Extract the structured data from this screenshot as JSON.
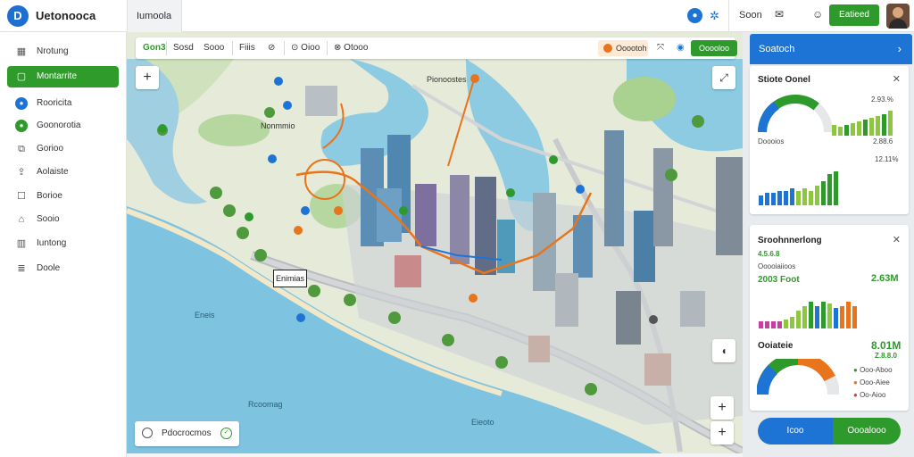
{
  "app": {
    "name": "Uetonooca",
    "tab": "Iumoola"
  },
  "topbar": {
    "search_label": "Soon",
    "action_label": "Eatieed"
  },
  "sidebar": {
    "items": [
      {
        "label": "Nrotung",
        "icon": "grid-icon"
      },
      {
        "label": "Montarrite",
        "icon": "square-icon"
      },
      {
        "label": "Rooricita",
        "icon": "blue-dot-icon"
      },
      {
        "label": "Goonorotia",
        "icon": "green-dot-icon"
      },
      {
        "label": "Gorioo",
        "icon": "stack-icon"
      },
      {
        "label": "Aolaiste",
        "icon": "share-icon"
      },
      {
        "label": "Borioe",
        "icon": "box-icon"
      },
      {
        "label": "Sooio",
        "icon": "home-icon"
      },
      {
        "label": "Iuntong",
        "icon": "chart-icon"
      },
      {
        "label": "Doole",
        "icon": "layers-icon"
      }
    ]
  },
  "map": {
    "toolbar": {
      "first": "Gon3",
      "items": [
        "Sosd",
        "Sooo",
        "Fiiis",
        "Oioo",
        "Otooo"
      ],
      "orange_label": "Ooootoh",
      "green_label": "Ooooloo"
    },
    "labels": {
      "place_top": "Pionoostes",
      "callout": "Enimias",
      "water1": "Eneis",
      "water2": "Rcoomag",
      "water3": "Eieoto",
      "district": "Nonmmio"
    },
    "bottom_search": "Pdocrocmos"
  },
  "panel": {
    "header": "Soatoch",
    "card1": {
      "title": "Stiote Oonel",
      "v1": "2.93.%",
      "v2": "2.88.6",
      "label": "Doooios",
      "v3": "12.11%",
      "gauge_level": 0.72,
      "bars_a": [
        6,
        5,
        6,
        7,
        8,
        9,
        10,
        11,
        12,
        14
      ],
      "bars_b": [
        4,
        5,
        5,
        6,
        6,
        7,
        6,
        7,
        6,
        8,
        10,
        13,
        14
      ]
    },
    "card2": {
      "title": "Sroohnnerlong",
      "stars": "4.5.6.8",
      "small1": "Ooooiaiioos",
      "big_left": "2003 Foot",
      "big_right": "2.63M",
      "bars": [
        3,
        3,
        3,
        3,
        4,
        5,
        8,
        10,
        12,
        10,
        12,
        11,
        9,
        10,
        12,
        10
      ],
      "section": "Ooiateie",
      "big_value": "8.01M",
      "big_sub": "Z.8.8.0",
      "legend": [
        "Ooo-Aboo",
        "Ooo-Aiee",
        "Oo-Aioo"
      ],
      "gauge_level": 0.85
    },
    "buttons": {
      "left": "Icoo",
      "right": "Oooalooo"
    }
  },
  "colors": {
    "green": "#2e9a2c",
    "blue": "#1e74d4",
    "orange": "#e8741c"
  }
}
